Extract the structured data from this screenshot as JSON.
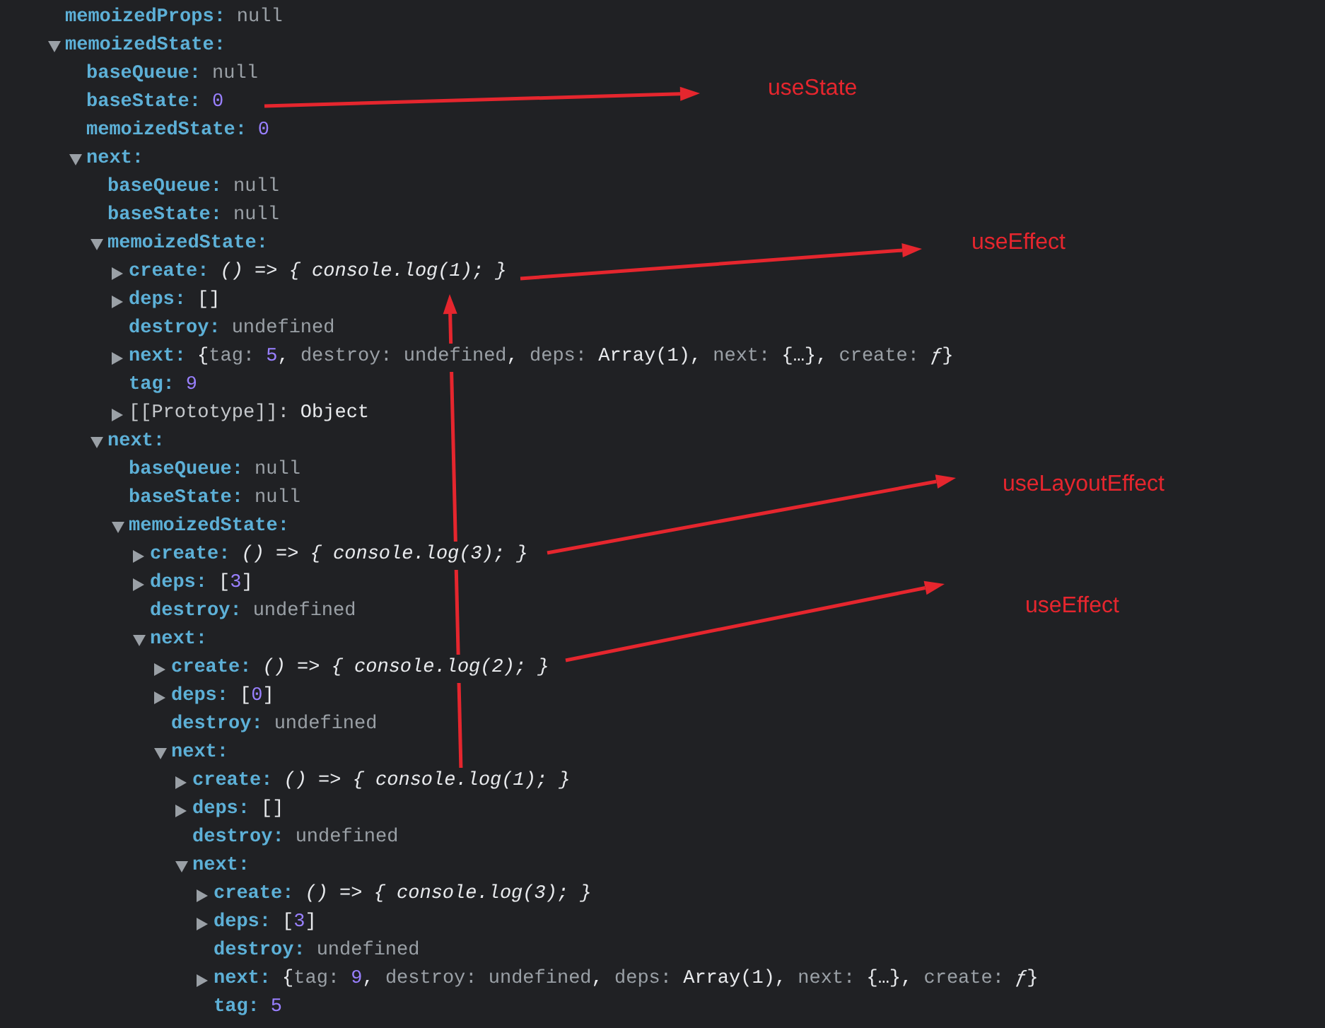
{
  "tree": [
    {
      "kind": "leaf",
      "key": "memoizedProps:",
      "value": [
        {
          "kind": "null",
          "text": "null"
        }
      ]
    },
    {
      "kind": "object",
      "expanded": true,
      "key": "memoizedState:",
      "children": [
        {
          "kind": "leaf",
          "key": "baseQueue:",
          "value": [
            {
              "kind": "null",
              "text": "null"
            }
          ]
        },
        {
          "kind": "leaf",
          "key": "baseState:",
          "value": [
            {
              "kind": "number",
              "text": "0"
            }
          ]
        },
        {
          "kind": "leaf",
          "key": "memoizedState:",
          "value": [
            {
              "kind": "number",
              "text": "0"
            }
          ]
        },
        {
          "kind": "object",
          "expanded": true,
          "key": "next:",
          "children": [
            {
              "kind": "leaf",
              "key": "baseQueue:",
              "value": [
                {
                  "kind": "null",
                  "text": "null"
                }
              ]
            },
            {
              "kind": "leaf",
              "key": "baseState:",
              "value": [
                {
                  "kind": "null",
                  "text": "null"
                }
              ]
            },
            {
              "kind": "object",
              "expanded": true,
              "key": "memoizedState:",
              "children": [
                {
                  "kind": "object",
                  "expanded": false,
                  "key": "create:",
                  "value": [
                    {
                      "kind": "fn",
                      "text": "() => { console.log(1); }"
                    }
                  ]
                },
                {
                  "kind": "object",
                  "expanded": false,
                  "key": "deps:",
                  "value": [
                    {
                      "kind": "punct",
                      "text": "[]"
                    }
                  ]
                },
                {
                  "kind": "leaf",
                  "key": "destroy:",
                  "value": [
                    {
                      "kind": "null",
                      "text": "undefined"
                    }
                  ]
                },
                {
                  "kind": "object",
                  "expanded": false,
                  "key": "next:",
                  "value": [
                    {
                      "kind": "punct",
                      "text": "{"
                    },
                    {
                      "kind": "pkey",
                      "text": "tag: "
                    },
                    {
                      "kind": "number",
                      "text": "5"
                    },
                    {
                      "kind": "punct",
                      "text": ", "
                    },
                    {
                      "kind": "pkey",
                      "text": "destroy: "
                    },
                    {
                      "kind": "null",
                      "text": "undefined"
                    },
                    {
                      "kind": "punct",
                      "text": ", "
                    },
                    {
                      "kind": "pkey",
                      "text": "deps: "
                    },
                    {
                      "kind": "punct",
                      "text": "Array(1)"
                    },
                    {
                      "kind": "punct",
                      "text": ", "
                    },
                    {
                      "kind": "pkey",
                      "text": "next: "
                    },
                    {
                      "kind": "punct",
                      "text": "{…}"
                    },
                    {
                      "kind": "punct",
                      "text": ", "
                    },
                    {
                      "kind": "pkey",
                      "text": "create: "
                    },
                    {
                      "kind": "fn",
                      "text": "ƒ"
                    },
                    {
                      "kind": "punct",
                      "text": "}"
                    }
                  ]
                },
                {
                  "kind": "leaf",
                  "key": "tag:",
                  "value": [
                    {
                      "kind": "number",
                      "text": "9"
                    }
                  ]
                },
                {
                  "kind": "internal",
                  "expanded": false,
                  "key": "[[Prototype]]:",
                  "value": [
                    {
                      "kind": "punct",
                      "text": "Object"
                    }
                  ]
                }
              ]
            },
            {
              "kind": "object",
              "expanded": true,
              "key": "next:",
              "children": [
                {
                  "kind": "leaf",
                  "key": "baseQueue:",
                  "value": [
                    {
                      "kind": "null",
                      "text": "null"
                    }
                  ]
                },
                {
                  "kind": "leaf",
                  "key": "baseState:",
                  "value": [
                    {
                      "kind": "null",
                      "text": "null"
                    }
                  ]
                },
                {
                  "kind": "object",
                  "expanded": true,
                  "key": "memoizedState:",
                  "children": [
                    {
                      "kind": "object",
                      "expanded": false,
                      "key": "create:",
                      "value": [
                        {
                          "kind": "fn",
                          "text": "() => { console.log(3); }"
                        }
                      ]
                    },
                    {
                      "kind": "object",
                      "expanded": false,
                      "key": "deps:",
                      "value": [
                        {
                          "kind": "punct",
                          "text": "["
                        },
                        {
                          "kind": "number",
                          "text": "3"
                        },
                        {
                          "kind": "punct",
                          "text": "]"
                        }
                      ]
                    },
                    {
                      "kind": "leaf",
                      "key": "destroy:",
                      "value": [
                        {
                          "kind": "null",
                          "text": "undefined"
                        }
                      ]
                    },
                    {
                      "kind": "object",
                      "expanded": true,
                      "key": "next:",
                      "children": [
                        {
                          "kind": "object",
                          "expanded": false,
                          "key": "create:",
                          "value": [
                            {
                              "kind": "fn",
                              "text": "() => { console.log(2); }"
                            }
                          ]
                        },
                        {
                          "kind": "object",
                          "expanded": false,
                          "key": "deps:",
                          "value": [
                            {
                              "kind": "punct",
                              "text": "["
                            },
                            {
                              "kind": "number",
                              "text": "0"
                            },
                            {
                              "kind": "punct",
                              "text": "]"
                            }
                          ]
                        },
                        {
                          "kind": "leaf",
                          "key": "destroy:",
                          "value": [
                            {
                              "kind": "null",
                              "text": "undefined"
                            }
                          ]
                        },
                        {
                          "kind": "object",
                          "expanded": true,
                          "key": "next:",
                          "children": [
                            {
                              "kind": "object",
                              "expanded": false,
                              "key": "create:",
                              "value": [
                                {
                                  "kind": "fn",
                                  "text": "() => { console.log(1); }"
                                }
                              ]
                            },
                            {
                              "kind": "object",
                              "expanded": false,
                              "key": "deps:",
                              "value": [
                                {
                                  "kind": "punct",
                                  "text": "[]"
                                }
                              ]
                            },
                            {
                              "kind": "leaf",
                              "key": "destroy:",
                              "value": [
                                {
                                  "kind": "null",
                                  "text": "undefined"
                                }
                              ]
                            },
                            {
                              "kind": "object",
                              "expanded": true,
                              "key": "next:",
                              "children": [
                                {
                                  "kind": "object",
                                  "expanded": false,
                                  "key": "create:",
                                  "value": [
                                    {
                                      "kind": "fn",
                                      "text": "() => { console.log(3); }"
                                    }
                                  ]
                                },
                                {
                                  "kind": "object",
                                  "expanded": false,
                                  "key": "deps:",
                                  "value": [
                                    {
                                      "kind": "punct",
                                      "text": "["
                                    },
                                    {
                                      "kind": "number",
                                      "text": "3"
                                    },
                                    {
                                      "kind": "punct",
                                      "text": "]"
                                    }
                                  ]
                                },
                                {
                                  "kind": "leaf",
                                  "key": "destroy:",
                                  "value": [
                                    {
                                      "kind": "null",
                                      "text": "undefined"
                                    }
                                  ]
                                },
                                {
                                  "kind": "object",
                                  "expanded": false,
                                  "key": "next:",
                                  "value": [
                                    {
                                      "kind": "punct",
                                      "text": "{"
                                    },
                                    {
                                      "kind": "pkey",
                                      "text": "tag: "
                                    },
                                    {
                                      "kind": "number",
                                      "text": "9"
                                    },
                                    {
                                      "kind": "punct",
                                      "text": ", "
                                    },
                                    {
                                      "kind": "pkey",
                                      "text": "destroy: "
                                    },
                                    {
                                      "kind": "null",
                                      "text": "undefined"
                                    },
                                    {
                                      "kind": "punct",
                                      "text": ", "
                                    },
                                    {
                                      "kind": "pkey",
                                      "text": "deps: "
                                    },
                                    {
                                      "kind": "punct",
                                      "text": "Array(1)"
                                    },
                                    {
                                      "kind": "punct",
                                      "text": ", "
                                    },
                                    {
                                      "kind": "pkey",
                                      "text": "next: "
                                    },
                                    {
                                      "kind": "punct",
                                      "text": "{…}"
                                    },
                                    {
                                      "kind": "punct",
                                      "text": ", "
                                    },
                                    {
                                      "kind": "pkey",
                                      "text": "create: "
                                    },
                                    {
                                      "kind": "fn",
                                      "text": "ƒ"
                                    },
                                    {
                                      "kind": "punct",
                                      "text": "}"
                                    }
                                  ]
                                },
                                {
                                  "kind": "leaf",
                                  "key": "tag:",
                                  "value": [
                                    {
                                      "kind": "number",
                                      "text": "5"
                                    }
                                  ]
                                }
                              ]
                            }
                          ]
                        }
                      ]
                    }
                  ]
                }
              ]
            }
          ]
        }
      ]
    }
  ],
  "annotations": [
    {
      "label": "useState"
    },
    {
      "label": "useEffect"
    },
    {
      "label": "useLayoutEffect"
    },
    {
      "label": "useEffect"
    }
  ]
}
